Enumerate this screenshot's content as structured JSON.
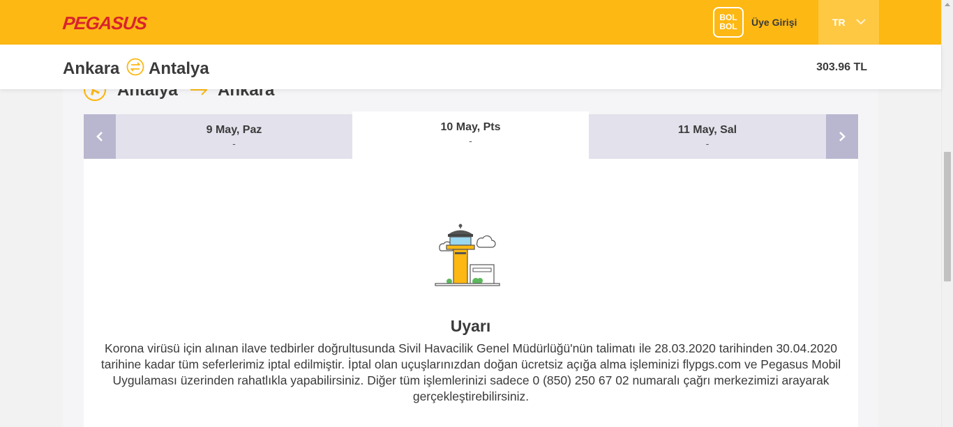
{
  "header": {
    "logo_text": "PEGASUS",
    "bolbol_line1": "BOL",
    "bolbol_line2": "BOL",
    "login_label": "Üye Girişi",
    "language": "TR"
  },
  "route": {
    "from": "Ankara",
    "to": "Antalya",
    "price": "303.96 TL"
  },
  "return_leg": {
    "from": "Antalya",
    "to": "Ankara"
  },
  "dates": [
    {
      "label": "9 May, Paz",
      "price": "-"
    },
    {
      "label": "10 May, Pts",
      "price": "-"
    },
    {
      "label": "11 May, Sal",
      "price": "-"
    }
  ],
  "warning": {
    "title": "Uyarı",
    "body": "Korona virüsü için alınan ilave tedbirler doğrultusunda Sivil Havacilik Genel Müdürlüğü'nün talimatı ile 28.03.2020 tarihinden 30.04.2020 tarihine kadar tüm seferlerimiz iptal edilmiştir. İptal olan uçuşlarınızdan doğan ücretsiz açığa alma işleminizi flypgs.com ve Pegasus Mobil Uygulaması üzerinden rahatlıkla yapabilirsiniz. Diğer tüm işlemlerinizi sadece 0 (850) 250 67 02 numaralı çağrı merkezimizi arayarak gerçekleştirebilirsiniz."
  },
  "colors": {
    "brand_yellow": "#fdb813",
    "logo_red": "#d9232d",
    "nav_purple": "#b9b7cf",
    "strip_lavender": "#e2e1ec"
  },
  "icons": {
    "swap": "swap-arrows-icon",
    "flight": "plane-circle-icon",
    "arrow": "arrow-right-icon",
    "prev": "chevron-left-icon",
    "next": "chevron-right-icon",
    "lang_dropdown": "chevron-down-icon",
    "illustration": "control-tower-icon"
  }
}
